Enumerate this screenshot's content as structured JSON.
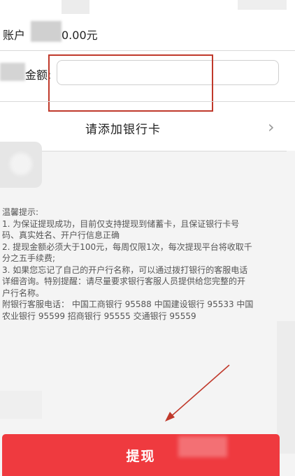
{
  "account": {
    "balance_label": "账户",
    "balance_value": "0.00元"
  },
  "withdraw_form": {
    "amount_label": "金额:",
    "amount_value": "",
    "amount_placeholder": ""
  },
  "bank_card": {
    "add_label": "请添加银行卡",
    "chevron_icon": "chevron-right-icon"
  },
  "tips": {
    "lines": [
      "温馨提示:",
      "1. 为保证提现成功，目前仅支持提现到储蓄卡，且保证银行卡号",
      "码、真实姓名、开户行信息正确",
      "2. 提现金额必须大于100元，每周仅限1次，每次提现平台将收取千",
      "分之五手续费;",
      "3. 如果您忘记了自己的开户行名称，可以通过拨打银行的客服电话",
      "详细咨询。特别提醒：请尽量要求银行客服人员提供给您完整的开",
      "户行名称。",
      "附银行客服电话：  中国工商银行 95588 中国建设银行 95533 中国",
      "农业银行 95599 招商银行 95555 交通银行 95559"
    ]
  },
  "submit": {
    "label": "提现"
  },
  "colors": {
    "accent_red": "#ef3a3f",
    "annotation_red": "#c0392b"
  }
}
